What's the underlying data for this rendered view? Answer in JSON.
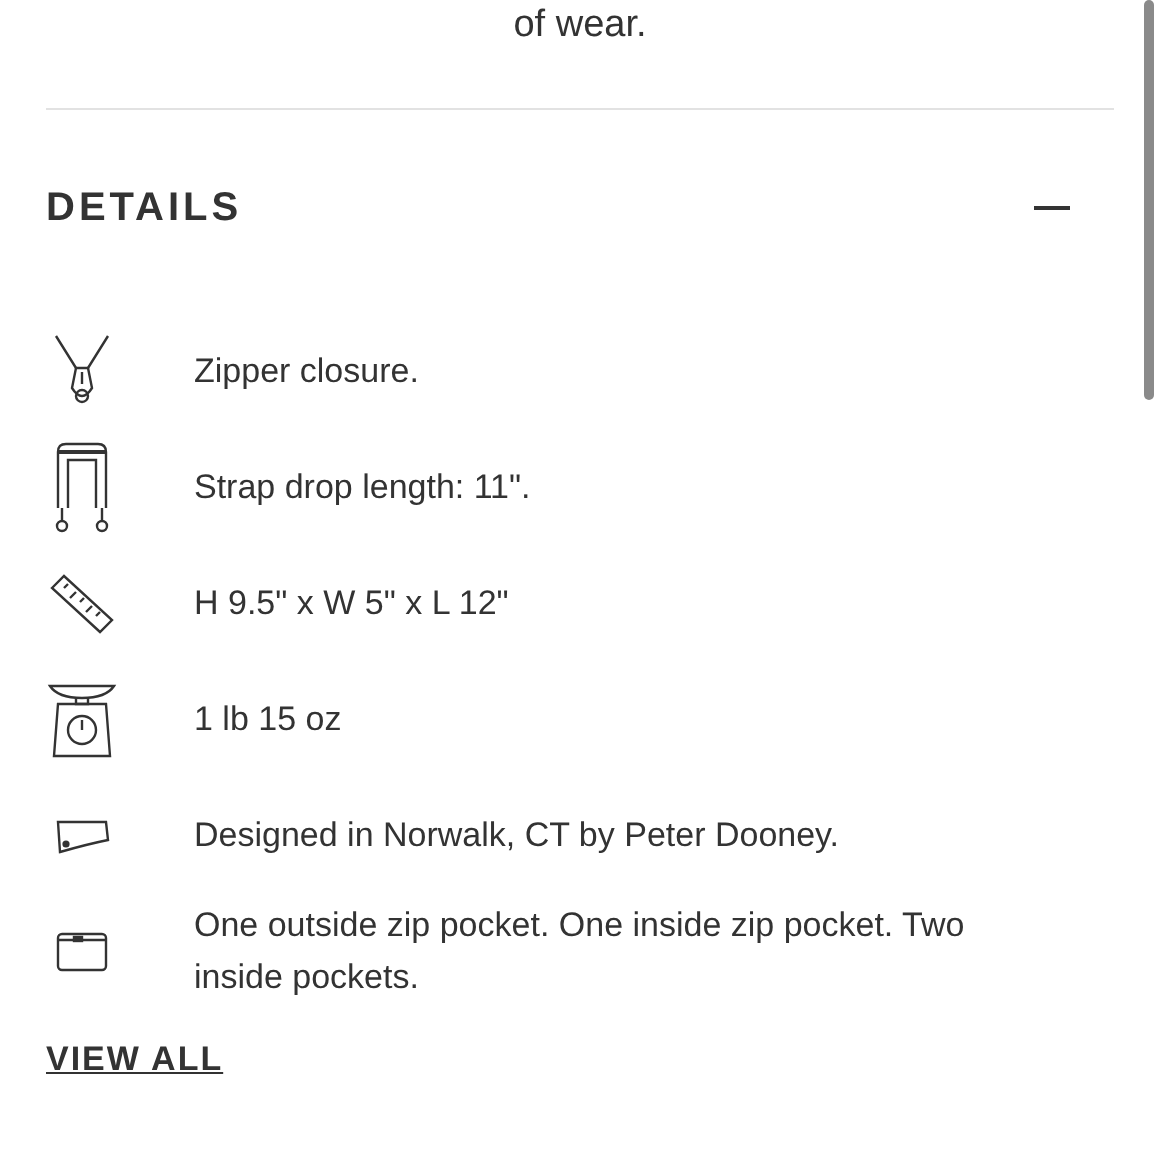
{
  "intro_text": "of wear.",
  "details": {
    "title": "DETAILS",
    "expanded": true,
    "items": [
      {
        "kind": "zipper",
        "text": "Zipper closure."
      },
      {
        "kind": "strap",
        "text": "Strap drop length: 11\"."
      },
      {
        "kind": "ruler",
        "text": "H 9.5\" x W 5\" x L 12\""
      },
      {
        "kind": "scale",
        "text": "1 lb 15 oz"
      },
      {
        "kind": "map",
        "text": "Designed in Norwalk, CT by Peter Dooney."
      },
      {
        "kind": "pouch",
        "text": "One outside zip pocket. One inside zip pocket. Two inside pockets."
      }
    ],
    "link": "VIEW ALL"
  }
}
